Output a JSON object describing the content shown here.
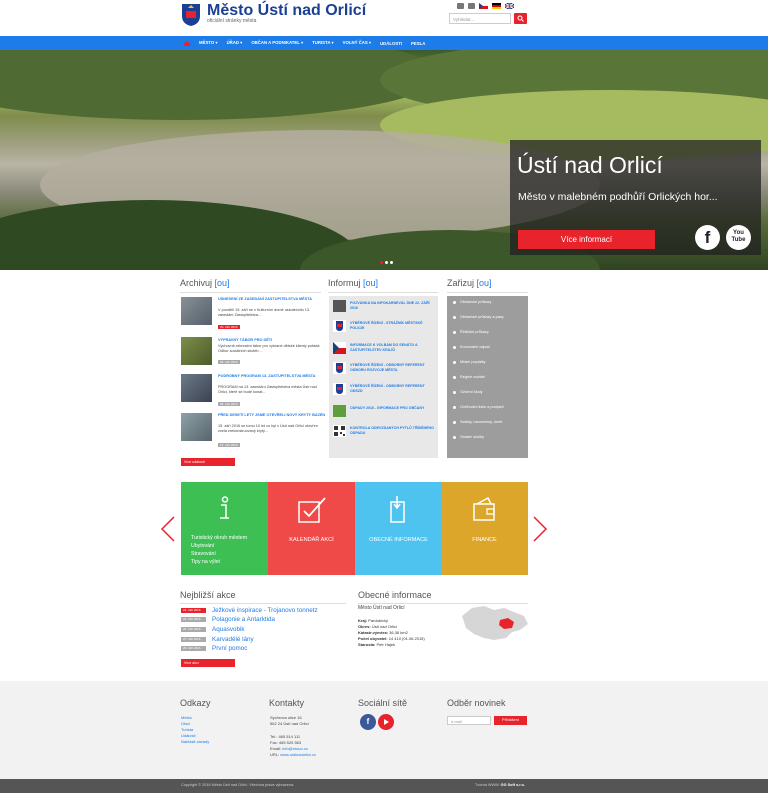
{
  "header": {
    "title": "Město Ústí nad Orlicí",
    "subtitle": "oficiální stránky města",
    "search_placeholder": "Vyhledat..."
  },
  "nav": {
    "items": [
      "Město ▾",
      "Úřad ▾",
      "Občan a podnikatel ▾",
      "Turista ▾",
      "Volný čas ▾",
      "Události",
      "Pesla"
    ]
  },
  "hero": {
    "title": "Ústí nad Orlicí",
    "subtitle": "Město v malebném podhůří Orlických hor...",
    "button": "Více informací",
    "youtube_top": "You",
    "youtube_bottom": "Tube"
  },
  "archive": {
    "title": "Archivuj",
    "bracket": "[ou]",
    "items": [
      {
        "title": "USNESENÍ ZE ZASEDÁNÍ ZASTUPITELSTVA MĚSTA",
        "text": "V pondělí 19. září se v Kulturním domě uskutečnilo 13. zasedání Zastupitelstva...",
        "date": "20. září 2016"
      },
      {
        "title": "VÝPRAVNÝ TÁBOR PRO DĚTI",
        "text": "Výchovně-rekreační tábor pro vybrané dětské klienty pořádá Odbor sociálních služeb...",
        "date": "09. září 2016"
      },
      {
        "title": "PODROBNÝ PROGRAM 13. ZASTUPITELSTVA MĚSTA",
        "text": "PROGRAM na 13. zasedání Zastupitelstva města Ústí nad Orlicí, které se bude konat...",
        "date": "06. září 2016"
      },
      {
        "title": "PŘED DESETI LETY JSME OTEVŘELI NOVÝ KRYTÝ BAZÉN",
        "text": "15. září 2016 se tomu 10 let co byl v Ústí nad Orlicí otevřen zcela zrekonstruovaný krytý...",
        "date": "15. září 2016"
      }
    ],
    "more": "Více událostí"
  },
  "inform": {
    "title": "Informuj",
    "bracket": "[ou]",
    "items": [
      "Pozvánka na infokarnevál dne 22. září 2016",
      "Výběrové řízení - strážník městské policie",
      "Informace k volbám do senátu a zastupitelstev krajů",
      "Výběrové řízení - odborný referent odboru rozvoje města",
      "Výběrové řízení - odborný referent ODSZD",
      "Odpady 2016 - informace pro občany",
      "Kontrola odevzdaných PyTlů tříděného odpadu"
    ]
  },
  "zariz": {
    "title": "Zařizuj",
    "bracket": "[ou]",
    "items": [
      "Občanské průkazy",
      "Občanské průkazy a pasy",
      "Řidičské průkazy",
      "Komunální odpad",
      "Místní poplatky",
      "Registr vozidel",
      "Oživení školy",
      "Ověřování listin a podpisů",
      "Svatby, narozeniny, úmrtí",
      "Ostatní služby"
    ]
  },
  "tiles": {
    "green_links": [
      "Turistický okruh městem",
      "Ubytování",
      "Stravování",
      "Tipy na výlet"
    ],
    "red": "Kalendář akcí",
    "blue": "Obecné informace",
    "yellow": "Finance"
  },
  "events": {
    "title": "Nejbližší akce",
    "items": [
      {
        "date": "22. září 2016",
        "name": "Ježkové inspirace - Trojanovo tonnetz",
        "color": "#e8232b"
      },
      {
        "date": "23. září 2016",
        "name": "Polagonie a Antarktida",
        "color": "#aaaaaa"
      },
      {
        "date": "26. září 2016",
        "name": "Aquasvobik",
        "color": "#aaaaaa"
      },
      {
        "date": "27. září 2016",
        "name": "Karvadělé lány",
        "color": "#aaaaaa"
      },
      {
        "date": "29. září 2016",
        "name": "První pomoc",
        "color": "#aaaaaa"
      }
    ],
    "more": "Více akcí"
  },
  "general": {
    "title": "Obecné informace",
    "subtitle": "Město Ústí nad Orlicí",
    "lines": [
      {
        "label": "Kraj:",
        "value": "Pardubický"
      },
      {
        "label": "Okres:",
        "value": "Ústí nad Orlicí"
      },
      {
        "label": "Katastr.výměra:",
        "value": "36,36 km2"
      },
      {
        "label": "Počet obyvatel:",
        "value": "14 410 (01.06.2015)"
      },
      {
        "label": "Starosta:",
        "value": "Petr Hájek"
      }
    ]
  },
  "footer": {
    "odkazy_title": "Odkazy",
    "odkazy": [
      "Město",
      "Úřad",
      "Turista",
      "Události",
      "Nahlásit závady"
    ],
    "kontakty_title": "Kontakty",
    "kontakty_address": [
      "Sychrova ulice 16",
      "562 24 Ústí nad Orlicí"
    ],
    "tel": "Tel.: 465 514 111",
    "fax": "Fax: 465 525 563",
    "email_label": "Email: ",
    "email": "info@muuo.cz",
    "url_label": "URL: ",
    "url": "www.ustinadorlici.cz",
    "social_title": "Sociální sítě",
    "newsletter_title": "Odběr novinek",
    "newsletter_placeholder": "e-mail",
    "newsletter_btn": "Přihlášení",
    "copyright": "Copyright © 2016 Město Ústí nad Orlicí. Všechna práva vyhrazena.",
    "creator_label": "Tvorba WWW: ",
    "creator": "GG Soft s.r.o."
  },
  "colors": {
    "accent": "#e8232b",
    "nav": "#1e7ce8",
    "green": "#3dbf54",
    "red": "#f04a48",
    "blue": "#4ec3f0",
    "yellow": "#dca62b"
  }
}
